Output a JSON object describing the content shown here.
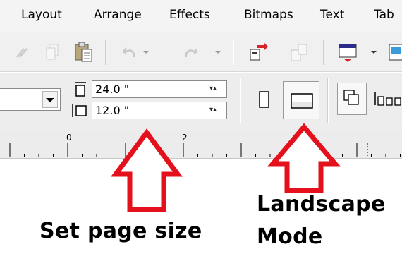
{
  "menubar": {
    "items": [
      "Layout",
      "Arrange",
      "Effects",
      "Bitmaps",
      "Text",
      "Tab"
    ]
  },
  "property_bar": {
    "page_width": "24.0 \"",
    "page_height": "12.0 \""
  },
  "ruler": {
    "labels": [
      "0",
      "2"
    ]
  },
  "annotations": {
    "set_page_size": "Set page size",
    "landscape_line1": "Landscape",
    "landscape_line2": "Mode"
  },
  "colors": {
    "arrow": "#e4101b",
    "menu_bg": "#f4f4f4",
    "toolbar_bg": "#f0f0f0"
  }
}
